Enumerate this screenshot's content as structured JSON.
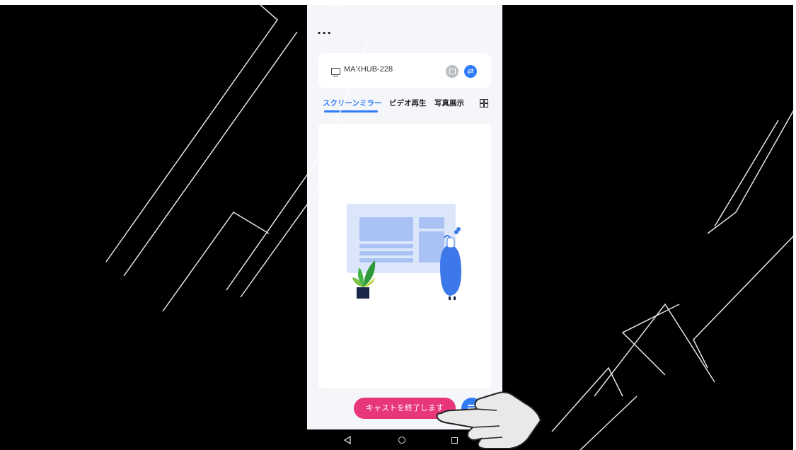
{
  "header": {
    "more_label": "..."
  },
  "device": {
    "name": "MAXHUB-228"
  },
  "tabs": [
    {
      "label": "スクリーンミラー",
      "active": true
    },
    {
      "label": "ビデオ再生",
      "active": false
    },
    {
      "label": "写真展示",
      "active": false
    }
  ],
  "actions": {
    "stop_cast_label": "キャストを終了します"
  },
  "icons": {
    "monitor": "monitor-icon",
    "cast": "cast-icon",
    "switch": "switch-icon",
    "grid": "grid-icon",
    "fab": "menu-fab-icon",
    "nav_back": "back-icon",
    "nav_home": "home-icon",
    "nav_recent": "recent-apps-icon"
  },
  "colors": {
    "accent": "#2f7cf6",
    "stop_button": "#e8367a",
    "background": "#000000",
    "panel": "#f4f6fa"
  }
}
